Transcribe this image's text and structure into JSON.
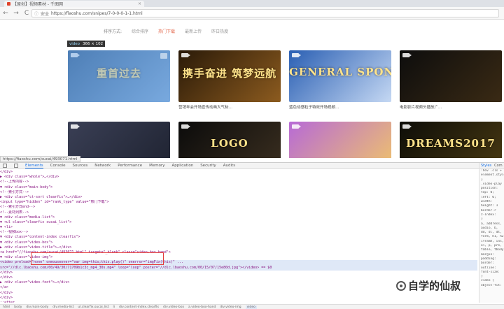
{
  "browser": {
    "tab_title": "【原创】视频素材 - 千图网",
    "tab_close": "×",
    "back": "←",
    "forward": "→",
    "reload": "C",
    "home": "⌂",
    "lock": "ⓘ",
    "secure_label": "安全",
    "url": "https://flaoshu.com/snipes/7-0-0-0-1-1.html"
  },
  "page": {
    "sort_label": "排序方式:",
    "sort_options": [
      "综合排序",
      "热门下载",
      "最新上传",
      "昨日热度"
    ],
    "hover_tip": {
      "tag": "video",
      "size": "366 × 102"
    },
    "cards": [
      {
        "thumb_text": "重首过去",
        "caption": "",
        "colors": [
          "#2c5b8f",
          "#7aa8d8"
        ]
      },
      {
        "thumb_text": "携手奋进 筑梦远航",
        "caption": "营销年会开场宣传动画大气标…",
        "colors": [
          "#2a1a08",
          "#8c5b1f"
        ]
      },
      {
        "thumb_text": "GENERAL SPONSOR",
        "caption": "蓝色动感粒子特效开场视频…",
        "colors": [
          "#2a5fb3",
          "#c5d8f3"
        ]
      },
      {
        "thumb_text": "",
        "caption": "电影影片视频头播放广…",
        "colors": [
          "#0d0d0d",
          "#3a2a14"
        ]
      },
      {
        "thumb_text": "",
        "caption": "",
        "colors": [
          "#3a3f55",
          "#1e2230"
        ]
      },
      {
        "thumb_text": "LOGO",
        "caption": "",
        "colors": [
          "#0b0b0b",
          "#3b2f20"
        ]
      },
      {
        "thumb_text": "",
        "caption": "",
        "colors": [
          "#b76ad6",
          "#f0c46a"
        ]
      },
      {
        "thumb_text": "DREAMS2017",
        "caption": "",
        "colors": [
          "#0d0d08",
          "#4a3a12"
        ]
      }
    ],
    "status_url": "https://fiaoshu.com/sucai/493071.html"
  },
  "devtools": {
    "tabs": [
      "Elements",
      "Console",
      "Sources",
      "Network",
      "Performance",
      "Memory",
      "Application",
      "Security",
      "Audits"
    ],
    "code_lines": [
      "  </div>",
      "  ▶ <div class=\"whole\">…</div>",
      "    <!--上传内容-->",
      "  ▼ <div class=\"main-body\">",
      "      <!--索引方式-->",
      "    ▶ <div class=\"ct-sort clearfix\">…</div>",
      "      <input type=\"hidden\" id=\"rank_type\" value=\"热门下载\">",
      "      <!--索引方式end-->",
      "      <!--素材列表-->",
      "    ▼ <div class=\"media-list\">",
      "      ▼ <ul class=\"clearfix sucai_list\">",
      "        ▼ <li>",
      "            <!--视频box-->",
      "          ▼ <div class=\"content-index clearfix\">",
      "            ▼ <div class=\"video-box\">",
      "              ▶ <div class=\"video-title\">…</div>",
      "                <a href=\"//fiaoshu.com/sucai/493071.html\" target=\"_blank\" class=\"video-box-hand\">",
      "              ▼ <div class=\"video-img\">",
      "                  <video preload=\"none\" onmouseover=\"var img=this;this.play()\" onerror=\"imgFix(this)\" ...",
      "                  src=\"//dlc.lbaoshu.com/00/49/30/71709b1c3c_mp4_30s.mp4\" loop=\"loop\" poster=\"//dlc.lbaoshu.com/00/15/07/15e80d.jpg\"></video> == $0",
      "                </div>",
      "              </div>",
      "            ▶ <div class=\"video-foot\">…</div>",
      "              </a>",
      "            </div>",
      "          </div>",
      "        ::after",
      "        </li>",
      "      ▶ <li>…</li>"
    ],
    "styles_tabs": [
      "Styles",
      "Com"
    ],
    "styles_rules": [
      ":hov .cls +",
      "element.style {",
      "}",
      ".video-play",
      "  position:",
      "  top: 0;",
      "  left: 0;",
      "  width:",
      "  height: 1",
      "  border-r",
      "  z-index:",
      "}",
      "a, address,",
      "audio, b,",
      "dd, dl, dt,",
      "form, h1, h2,",
      "iframe, ins,",
      "ol, p, pre,",
      "table, tbody,",
      "  margin:",
      "  padding:",
      "  border:",
      "  outline:",
      "  font-size:",
      "}",
      "video {",
      "  object-fit:"
    ],
    "breadcrumbs": [
      "html",
      "body",
      "div.main-body",
      "div.media-list",
      "ul.clearfix.sucai_list",
      "li",
      "div.content-index.clearfix",
      "div.video-box",
      "a.video-box-hand",
      "div.video-img",
      "video"
    ]
  },
  "watermark": {
    "text": "自学的仙叔"
  }
}
